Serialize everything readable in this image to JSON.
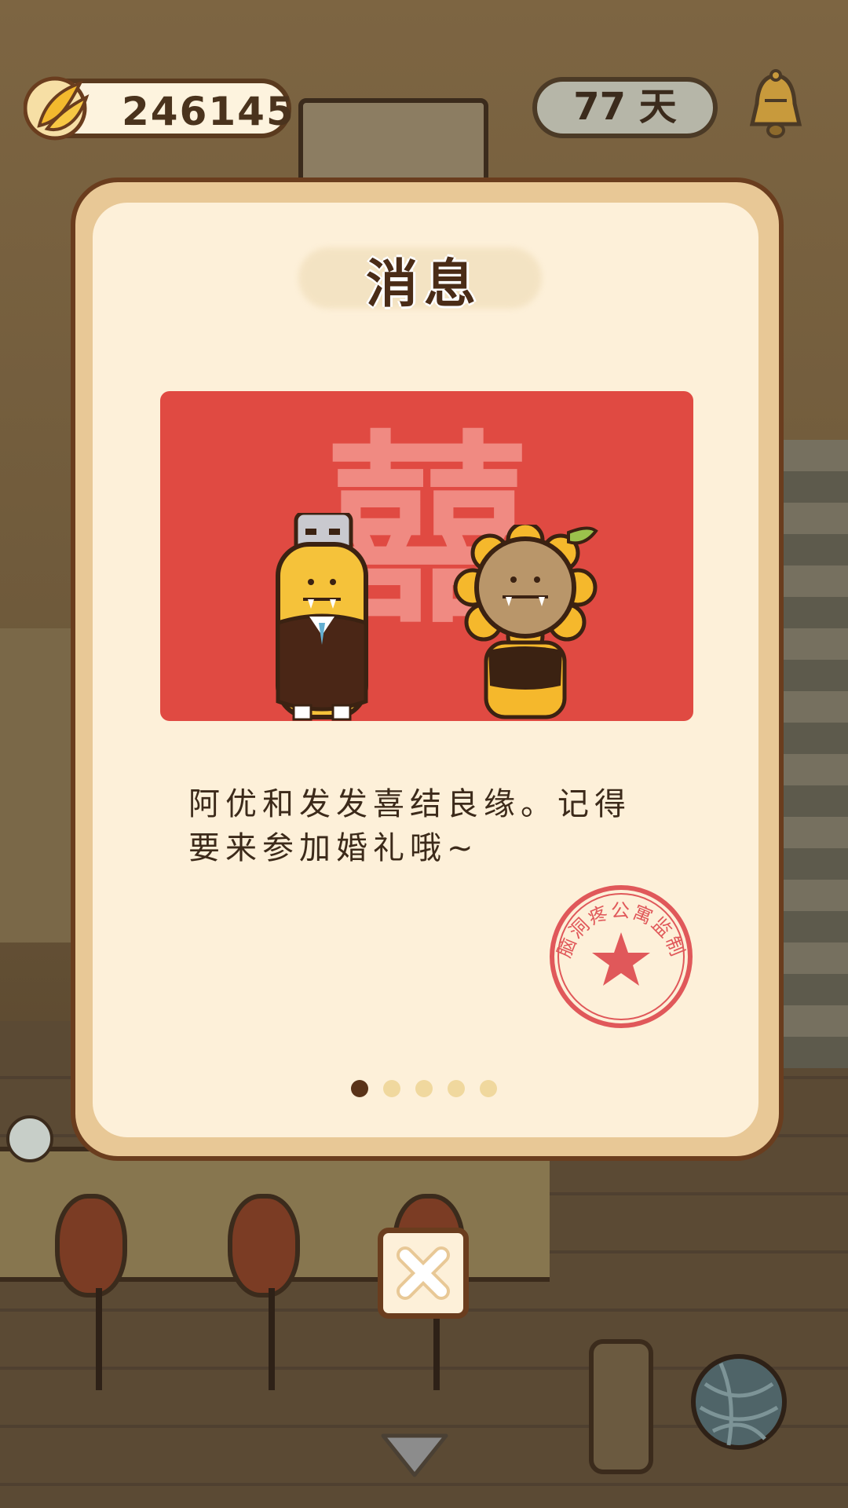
{
  "hud": {
    "coins": "246145",
    "days": "77 天"
  },
  "modal": {
    "title": "消息",
    "card_glyph": "囍",
    "message_line1": "阿优和发发喜结良缘。记得",
    "message_line2": "要来参加婚礼哦~",
    "stamp_text": "脑洞疼公寓监制",
    "page_count": 5,
    "active_page": 1
  },
  "icons": {
    "coin": "banana-icon",
    "notification": "bell-icon",
    "close": "close-icon",
    "collapse": "chevron-down-icon",
    "yarn": "yarn-ball-icon"
  },
  "colors": {
    "card_red": "#e04a42",
    "modal_bg": "#fdf0d9",
    "modal_border": "#e8c896",
    "text_brown": "#4a2c17",
    "stamp_red": "#e0585a"
  }
}
